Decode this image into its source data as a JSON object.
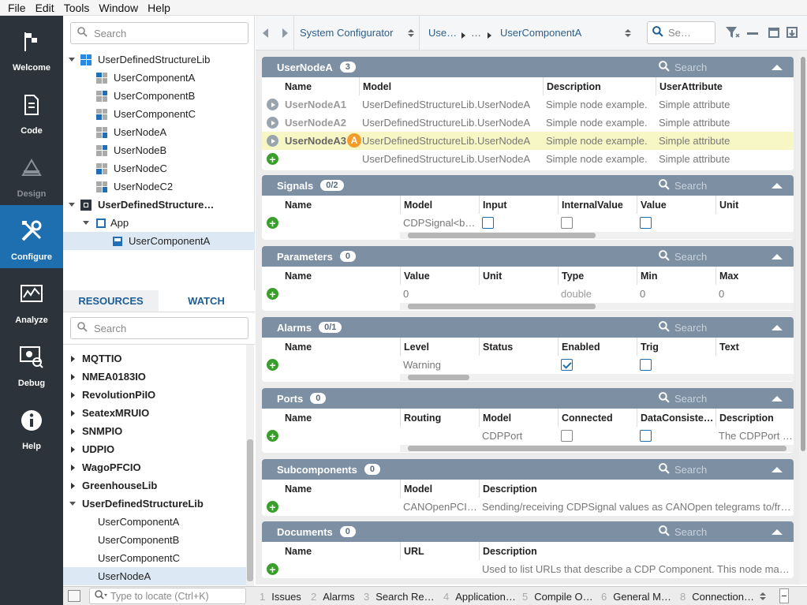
{
  "menu": [
    "File",
    "Edit",
    "Tools",
    "Window",
    "Help"
  ],
  "nav": [
    {
      "label": "Welcome",
      "icon": "flag-icon"
    },
    {
      "label": "Code",
      "icon": "document-icon"
    },
    {
      "label": "Design",
      "icon": "design-icon"
    },
    {
      "label": "Configure",
      "icon": "tools-icon"
    },
    {
      "label": "Analyze",
      "icon": "chart-icon"
    },
    {
      "label": "Debug",
      "icon": "debug-icon"
    },
    {
      "label": "Help",
      "icon": "info-icon"
    }
  ],
  "tree": {
    "search_placeholder": "Search",
    "items": [
      {
        "label": "UserDefinedStructureLib"
      },
      {
        "label": "UserComponentA"
      },
      {
        "label": "UserComponentB"
      },
      {
        "label": "UserComponentC"
      },
      {
        "label": "UserNodeA"
      },
      {
        "label": "UserNodeB"
      },
      {
        "label": "UserNodeC"
      },
      {
        "label": "UserNodeC2"
      },
      {
        "label": "UserDefinedStructure…"
      },
      {
        "label": "App"
      },
      {
        "label": "UserComponentA"
      }
    ]
  },
  "resources": {
    "tabs": [
      "RESOURCES",
      "WATCH"
    ],
    "search_placeholder": "Search",
    "items": [
      "MQTTIO",
      "NMEA0183IO",
      "RevolutionPiIO",
      "SeatexMRUIO",
      "SNMPIO",
      "UDPIO",
      "WagoPFCIO",
      "GreenhouseLib",
      "UserDefinedStructureLib",
      "UserComponentA",
      "UserComponentB",
      "UserComponentC",
      "UserNodeA"
    ]
  },
  "topbar": {
    "configurator": "System Configurator",
    "crumb1": "Use…",
    "crumb2": "…",
    "crumb3": "UserComponentA",
    "search_placeholder": "Se…"
  },
  "sections": {
    "usernodeA": {
      "title": "UserNodeA",
      "badge": "3",
      "search": "Search",
      "columns": [
        "Name",
        "Model",
        "Description",
        "UserAttribute"
      ],
      "rows": [
        {
          "name": "UserNodeA1",
          "model": "UserDefinedStructureLib.UserNodeA",
          "desc": "Simple node example.",
          "attr": "Simple attribute"
        },
        {
          "name": "UserNodeA2",
          "model": "UserDefinedStructureLib.UserNodeA",
          "desc": "Simple node example.",
          "attr": "Simple attribute"
        },
        {
          "name": "UserNodeA3",
          "model": "UserDefinedStructureLib.UserNodeA",
          "desc": "Simple node example.",
          "attr": "Simple attribute"
        },
        {
          "name": "",
          "model": "UserDefinedStructureLib.UserNodeA",
          "desc": "Simple node example.",
          "attr": "Simple attribute"
        }
      ],
      "marker": "A"
    },
    "signals": {
      "title": "Signals",
      "badge": "0/2",
      "search": "Search",
      "columns": [
        "Name",
        "Model",
        "Input",
        "InternalValue",
        "Value",
        "Unit"
      ],
      "row": {
        "model": "CDPSignal<b…"
      }
    },
    "parameters": {
      "title": "Parameters",
      "badge": "0",
      "search": "Search",
      "columns": [
        "Name",
        "Value",
        "Unit",
        "Type",
        "Min",
        "Max"
      ],
      "row": {
        "value": "0",
        "type": "double",
        "min": "0",
        "max": "0"
      }
    },
    "alarms": {
      "title": "Alarms",
      "badge": "0/1",
      "search": "Search",
      "columns": [
        "Name",
        "Level",
        "Status",
        "Enabled",
        "Trig",
        "Text"
      ],
      "row": {
        "level": "Warning"
      }
    },
    "ports": {
      "title": "Ports",
      "badge": "0",
      "search": "Search",
      "columns": [
        "Name",
        "Routing",
        "Model",
        "Connected",
        "DataConsiste…",
        "Description"
      ],
      "row": {
        "model": "CDPPort",
        "desc": "The CDPPort …"
      }
    },
    "subcomponents": {
      "title": "Subcomponents",
      "badge": "0",
      "search": "Search",
      "columns": [
        "Name",
        "Model",
        "Description"
      ],
      "row": {
        "model": "CANOpenPCI…",
        "desc": "Sending/receiving CDPSignal values as CANOpen telegrams to/fr…"
      }
    },
    "documents": {
      "title": "Documents",
      "badge": "0",
      "search": "Search",
      "columns": [
        "Name",
        "URL",
        "Description"
      ],
      "row": {
        "desc": "Used to list URLs that describe a CDP Component. This node ma…"
      }
    }
  },
  "bottom": {
    "locate_placeholder": "Type to locate (Ctrl+K)",
    "tabs": [
      {
        "n": "1",
        "label": "Issues"
      },
      {
        "n": "2",
        "label": "Alarms"
      },
      {
        "n": "3",
        "label": "Search Re…"
      },
      {
        "n": "4",
        "label": "Application…"
      },
      {
        "n": "5",
        "label": "Compile O…"
      },
      {
        "n": "6",
        "label": "General M…"
      },
      {
        "n": "8",
        "label": "Connection…"
      }
    ]
  }
}
